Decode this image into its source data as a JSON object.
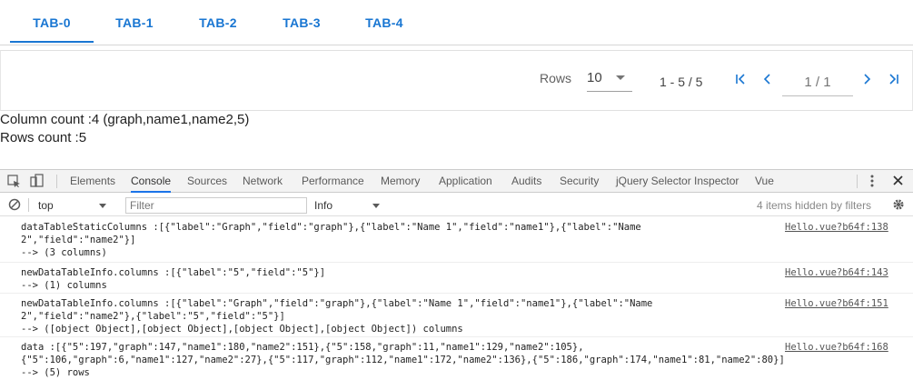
{
  "tabs": [
    "TAB-0",
    "TAB-1",
    "TAB-2",
    "TAB-3",
    "TAB-4"
  ],
  "active_tab": "TAB-0",
  "accent_color": "#1976d2",
  "pagination": {
    "rows_label": "Rows",
    "rows_per_page": "10",
    "range": "1 - 5 / 5",
    "page": "1 / 1",
    "first_icon": "first-page-icon",
    "prev_icon": "chevron-left-icon",
    "next_icon": "chevron-right-icon",
    "last_icon": "last-page-icon"
  },
  "info": {
    "column_count": "Column count :4 (graph,name1,name2,5)",
    "rows_count": "Rows count :5"
  },
  "devtools": {
    "tabs": [
      "Elements",
      "Console",
      "Sources",
      "Network",
      "Performance",
      "Memory",
      "Application",
      "Audits",
      "Security",
      "jQuery Selector Inspector",
      "Vue"
    ],
    "active_tab": "Console",
    "context": "top",
    "filter_placeholder": "Filter",
    "level": "Info",
    "hidden_note": "4 items hidden by filters",
    "logs": [
      {
        "text": "dataTableStaticColumns :[{\"label\":\"Graph\",\"field\":\"graph\"},{\"label\":\"Name 1\",\"field\":\"name1\"},{\"label\":\"Name\n2\",\"field\":\"name2\"}]\n--> (3 columns)",
        "source": "Hello.vue?b64f:138"
      },
      {
        "text": "newDataTableInfo.columns :[{\"label\":\"5\",\"field\":\"5\"}]\n--> (1) columns",
        "source": "Hello.vue?b64f:143"
      },
      {
        "text": "newDataTableInfo.columns :[{\"label\":\"Graph\",\"field\":\"graph\"},{\"label\":\"Name 1\",\"field\":\"name1\"},{\"label\":\"Name\n2\",\"field\":\"name2\"},{\"label\":\"5\",\"field\":\"5\"}]\n--> ([object Object],[object Object],[object Object],[object Object]) columns",
        "source": "Hello.vue?b64f:151"
      },
      {
        "text": "data :[{\"5\":197,\"graph\":147,\"name1\":180,\"name2\":151},{\"5\":158,\"graph\":11,\"name1\":129,\"name2\":105},\n{\"5\":106,\"graph\":6,\"name1\":127,\"name2\":27},{\"5\":117,\"graph\":112,\"name1\":172,\"name2\":136},{\"5\":186,\"graph\":174,\"name1\":81,\"name2\":80}]\n--> (5) rows",
        "source": "Hello.vue?b64f:168"
      }
    ]
  }
}
